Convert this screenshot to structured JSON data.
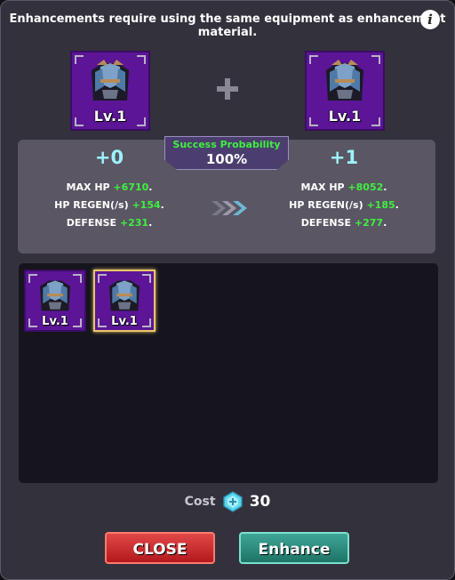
{
  "header": {
    "notice": "Enhancements require using the same equipment as enhancement material.",
    "info_icon": "info-icon",
    "info_glyph": "i"
  },
  "current_item": {
    "level": "Lv.1",
    "enhance": "+0",
    "icon": "armor-icon"
  },
  "result_item": {
    "level": "Lv.1",
    "enhance": "+1",
    "icon": "armor-icon"
  },
  "probability": {
    "label": "Success Probability",
    "value": "100%"
  },
  "current_stats": [
    {
      "label": "MAX HP ",
      "value": "+6710",
      "suffix": "."
    },
    {
      "label": "HP REGEN(/s) ",
      "value": "+154",
      "suffix": "."
    },
    {
      "label": "DEFENSE ",
      "value": "+231",
      "suffix": "."
    }
  ],
  "result_stats": [
    {
      "label": "MAX HP ",
      "value": "+8052",
      "suffix": "."
    },
    {
      "label": "HP REGEN(/s) ",
      "value": "+185",
      "suffix": "."
    },
    {
      "label": "DEFENSE ",
      "value": "+277",
      "suffix": "."
    }
  ],
  "inventory": [
    {
      "level": "Lv.1",
      "selected": false
    },
    {
      "level": "Lv.1",
      "selected": true
    }
  ],
  "cost": {
    "label": "Cost",
    "value": "30",
    "icon": "gem-icon"
  },
  "buttons": {
    "close": "CLOSE",
    "enhance": "Enhance"
  },
  "colors": {
    "stat_bonus": "#3ff03f",
    "level_number": "#9df1ff",
    "slot_bg": "#5b1596"
  }
}
